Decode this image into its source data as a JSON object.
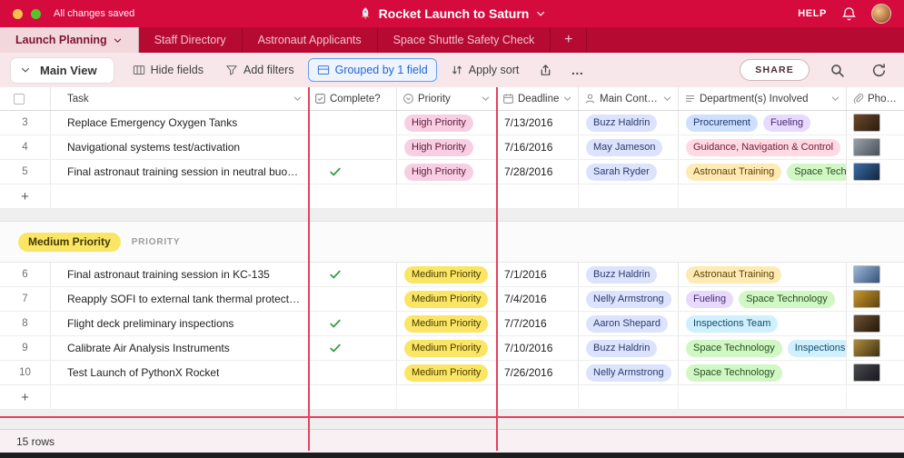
{
  "topbar": {
    "status_text": "All changes saved",
    "title": "Rocket Launch to Saturn",
    "title_icon": "rocket",
    "help_label": "HELP"
  },
  "tabs": {
    "items": [
      {
        "label": "Launch Planning",
        "active": true
      },
      {
        "label": "Staff Directory",
        "active": false
      },
      {
        "label": "Astronaut Applicants",
        "active": false
      },
      {
        "label": "Space Shuttle Safety Check",
        "active": false
      }
    ],
    "add_label": "+"
  },
  "toolbar": {
    "view_name": "Main View",
    "buttons": [
      {
        "label": "Hide fields",
        "icon": "grid",
        "highlighted": false
      },
      {
        "label": "Add filters",
        "icon": "funnel",
        "highlighted": false
      },
      {
        "label": "Grouped by 1 field",
        "icon": "group",
        "highlighted": true
      },
      {
        "label": "Apply sort",
        "icon": "sort",
        "highlighted": false
      }
    ],
    "ellipsis": "…",
    "share_label": "SHARE"
  },
  "table": {
    "columns": [
      {
        "key": "task",
        "label": "Task",
        "icon": null,
        "caret": true
      },
      {
        "key": "complete",
        "label": "Complete?",
        "icon": "checkbox-checked",
        "caret": false
      },
      {
        "key": "priority",
        "label": "Priority",
        "icon": "select",
        "caret": true
      },
      {
        "key": "deadline",
        "label": "Deadline",
        "icon": "calendar",
        "caret": true
      },
      {
        "key": "contact",
        "label": "Main Contact",
        "icon": "person",
        "caret": true
      },
      {
        "key": "dept",
        "label": "Department(s) Involved",
        "icon": "multiselect",
        "caret": true
      },
      {
        "key": "photo",
        "label": "Photo(s)",
        "icon": "paperclip",
        "caret": false
      }
    ],
    "colors": {
      "priority": {
        "High Priority": {
          "bg": "#f8cfe2",
          "text": "#5c1638"
        },
        "Medium Priority": {
          "bg": "#fbe565",
          "text": "#423a00"
        }
      },
      "contact": {
        "bg": "#dbe3fd",
        "text": "#2b3a6b"
      },
      "department": {
        "Procurement": {
          "bg": "#cfdfff",
          "text": "#1d3a71"
        },
        "Fueling": {
          "bg": "#e8dafc",
          "text": "#43297a"
        },
        "Guidance, Navigation & Control": {
          "bg": "#ffd9e4",
          "text": "#6e1a38"
        },
        "Astronaut Training": {
          "bg": "#ffeab6",
          "text": "#5e4300"
        },
        "Space Technology": {
          "bg": "#d1f7c4",
          "text": "#245021"
        },
        "Inspections Team": {
          "bg": "#d0f0fd",
          "text": "#0f4c6e"
        },
        "Inspections": {
          "bg": "#d0f0fd",
          "text": "#0f4c6e"
        }
      }
    },
    "groups": [
      {
        "header": null,
        "rows": [
          {
            "num": "3",
            "task": "Replace Emergency Oxygen Tanks",
            "complete": false,
            "priority": "High Priority",
            "deadline": "7/13/2016",
            "contact": "Buzz Haldrin",
            "departments": [
              "Procurement",
              "Fueling"
            ],
            "photo": {
              "c1": "#6b4a2b",
              "c2": "#2a1c10"
            }
          },
          {
            "num": "4",
            "task": "Navigational systems test/activation",
            "complete": false,
            "priority": "High Priority",
            "deadline": "7/16/2016",
            "contact": "May Jameson",
            "departments": [
              "Guidance, Navigation & Control"
            ],
            "photo": {
              "c1": "#9aa2ad",
              "c2": "#4a4f58"
            }
          },
          {
            "num": "5",
            "task": "Final astronaut training session in neutral buoyan...",
            "complete": true,
            "priority": "High Priority",
            "deadline": "7/28/2016",
            "contact": "Sarah Ryder",
            "departments": [
              "Astronaut Training",
              "Space Technology"
            ],
            "photo": {
              "c1": "#3b6ea8",
              "c2": "#13243c"
            }
          }
        ],
        "add_row_label": "+"
      },
      {
        "header": {
          "badge": "Medium Priority",
          "field_label": "PRIORITY"
        },
        "rows": [
          {
            "num": "6",
            "task": "Final astronaut training session in KC-135",
            "complete": true,
            "priority": "Medium Priority",
            "deadline": "7/1/2016",
            "contact": "Buzz Haldrin",
            "departments": [
              "Astronaut Training"
            ],
            "photo": {
              "c1": "#9db8d8",
              "c2": "#35527a"
            }
          },
          {
            "num": "7",
            "task": "Reapply SOFI to external tank thermal protection...",
            "complete": false,
            "priority": "Medium Priority",
            "deadline": "7/4/2016",
            "contact": "Nelly Armstrong",
            "departments": [
              "Fueling",
              "Space Technology"
            ],
            "photo": {
              "c1": "#c9972d",
              "c2": "#5e4510"
            }
          },
          {
            "num": "8",
            "task": "Flight deck preliminary inspections",
            "complete": true,
            "priority": "Medium Priority",
            "deadline": "7/7/2016",
            "contact": "Aaron Shepard",
            "departments": [
              "Inspections Team"
            ],
            "photo": {
              "c1": "#6e5136",
              "c2": "#241708"
            }
          },
          {
            "num": "9",
            "task": "Calibrate Air Analysis Instruments",
            "complete": true,
            "priority": "Medium Priority",
            "deadline": "7/10/2016",
            "contact": "Buzz Haldrin",
            "departments": [
              "Space Technology",
              "Inspections"
            ],
            "photo": {
              "c1": "#b08d3f",
              "c2": "#403112"
            }
          },
          {
            "num": "10",
            "task": "Test Launch of PythonX Rocket",
            "complete": false,
            "priority": "Medium Priority",
            "deadline": "7/26/2016",
            "contact": "Nelly Armstrong",
            "departments": [
              "Space Technology"
            ],
            "photo": {
              "c1": "#4a4a52",
              "c2": "#17171c"
            }
          }
        ],
        "add_row_label": "+"
      }
    ]
  },
  "footer": {
    "row_count_label": "15 rows"
  },
  "theme": {
    "topbar_bg": "#d50b3e",
    "tabbar_bg": "#b60a33",
    "active_tab_bg": "#f2d8dd",
    "toolbar_bg": "#f7e7ea",
    "accent_red_line": "#e9405c",
    "grouped_button_border": "#619ef8",
    "grouped_button_text": "#1f64d2",
    "check_green": "#2f9e44"
  }
}
